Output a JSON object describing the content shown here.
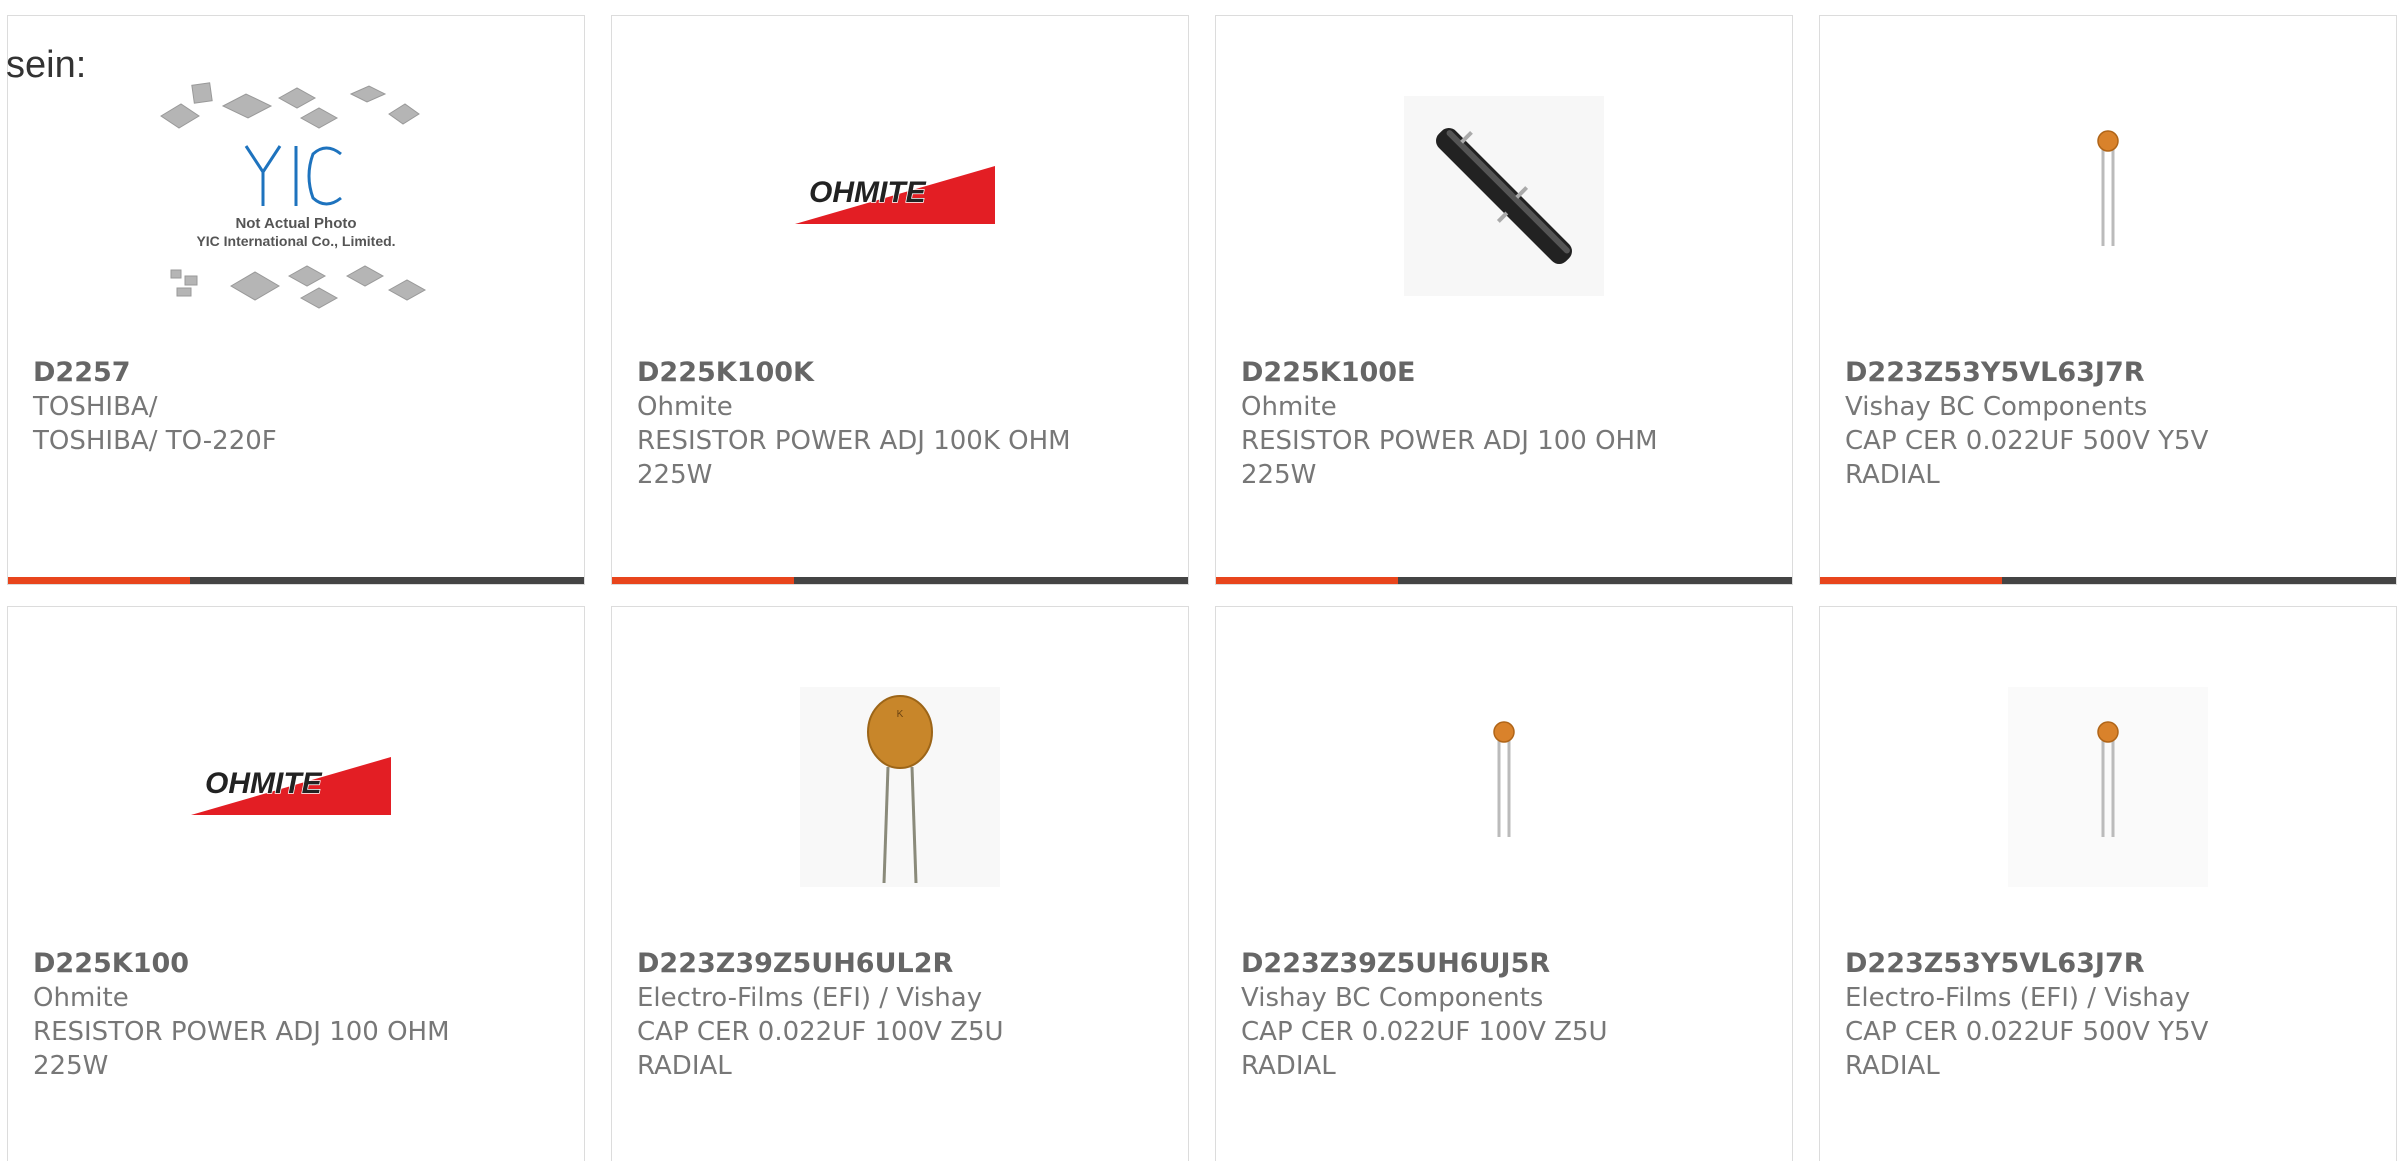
{
  "lead_text": "sein:",
  "colors": {
    "accent": "#e8451c",
    "bar": "#444444",
    "border": "#dcdcdc",
    "ohmite_red": "#e31e24",
    "capacitor_orange": "#d9822b"
  },
  "cards": [
    {
      "part_no": "D2257",
      "manufacturer": "TOSHIBA/",
      "description": "TOSHIBA/ TO-220F",
      "image": "yic-placeholder",
      "image_text_1": "Not Actual Photo",
      "image_text_2": "YIC International Co., Limited.",
      "image_logo": "YIC"
    },
    {
      "part_no": "D225K100K",
      "manufacturer": "Ohmite",
      "description": "RESISTOR POWER ADJ 100K OHM 225W",
      "image": "ohmite-logo",
      "image_logo": "OHMITE"
    },
    {
      "part_no": "D225K100E",
      "manufacturer": "Ohmite",
      "description": "RESISTOR POWER ADJ 100 OHM 225W",
      "image": "power-resistor"
    },
    {
      "part_no": "D223Z53Y5VL63J7R",
      "manufacturer": "Vishay BC Components",
      "description": "CAP CER 0.022UF 500V Y5V RADIAL",
      "image": "small-capacitor"
    },
    {
      "part_no": "D225K100",
      "manufacturer": "Ohmite",
      "description": "RESISTOR POWER ADJ 100 OHM 225W",
      "image": "ohmite-logo",
      "image_logo": "OHMITE"
    },
    {
      "part_no": "D223Z39Z5UH6UL2R",
      "manufacturer": "Electro-Films (EFI) / Vishay",
      "description": "CAP CER 0.022UF 100V Z5U RADIAL",
      "image": "large-capacitor"
    },
    {
      "part_no": "D223Z39Z5UH6UJ5R",
      "manufacturer": "Vishay BC Components",
      "description": "CAP CER 0.022UF 100V Z5U RADIAL",
      "image": "small-capacitor"
    },
    {
      "part_no": "D223Z53Y5VL63J7R",
      "manufacturer": "Electro-Films (EFI) / Vishay",
      "description": "CAP CER 0.022UF 500V Y5V RADIAL",
      "image": "small-capacitor"
    }
  ]
}
